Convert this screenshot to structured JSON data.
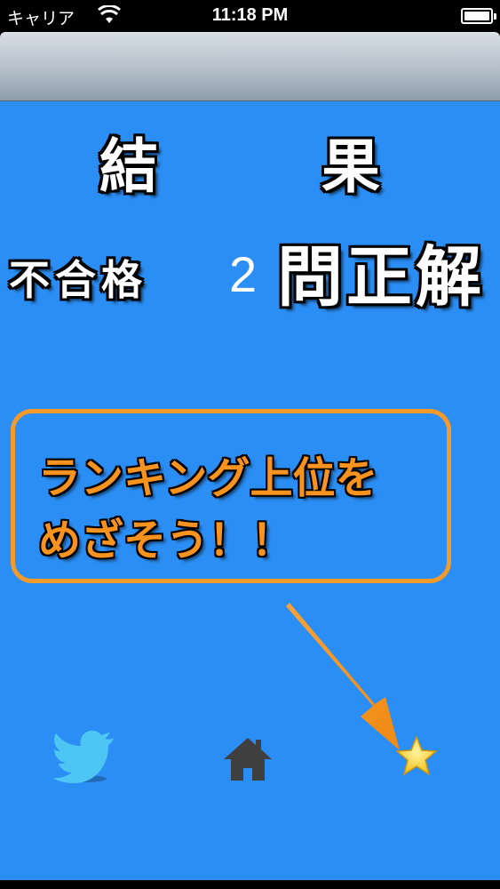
{
  "status_bar": {
    "carrier": "キャリア",
    "time": "11:18 PM",
    "icons": [
      "wifi-icon",
      "battery-icon"
    ]
  },
  "result": {
    "title_left": "結",
    "title_right": "果",
    "verdict": "不合格",
    "correct_count": "2",
    "correct_label": "問正解"
  },
  "message": {
    "line1": "ランキング上位を",
    "line2": "めざそう！！"
  },
  "toolbar": {
    "buttons": [
      {
        "name": "twitter",
        "icon": "twitter-bird-icon"
      },
      {
        "name": "home",
        "icon": "home-icon"
      },
      {
        "name": "ranking",
        "icon": "star-icon"
      }
    ]
  },
  "colors": {
    "background": "#2b8ef4",
    "accent_orange": "#f7931e",
    "twitter_blue": "#4dc6f3",
    "home_gray": "#3f3f3f",
    "star_yellow": "#f9d43a"
  }
}
